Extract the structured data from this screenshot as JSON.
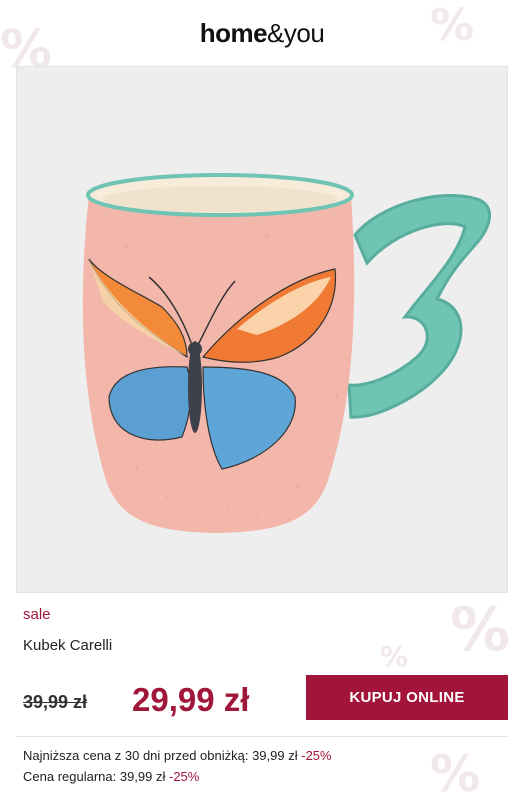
{
  "header": {
    "logo_home": "home",
    "logo_amp": "&",
    "logo_you": "you"
  },
  "product": {
    "badge": "sale",
    "name": "Kubek Carelli",
    "old_price": "39,99 zł",
    "new_price": "29,99 zł",
    "buy_label": "KUPUJ ONLINE",
    "image_icon": "butterfly-mug-image"
  },
  "info": {
    "lowest_label": "Najniższa cena z 30 dni przed obniżką: 39,99 zł",
    "lowest_pct": "-25%",
    "regular_label": "Cena regularna: 39,99 zł",
    "regular_pct": "-25%"
  },
  "colors": {
    "accent": "#a3143a",
    "mug_body": "#f3b6ab",
    "mug_handle": "#6fc4b4",
    "background": "#eeeeee"
  }
}
